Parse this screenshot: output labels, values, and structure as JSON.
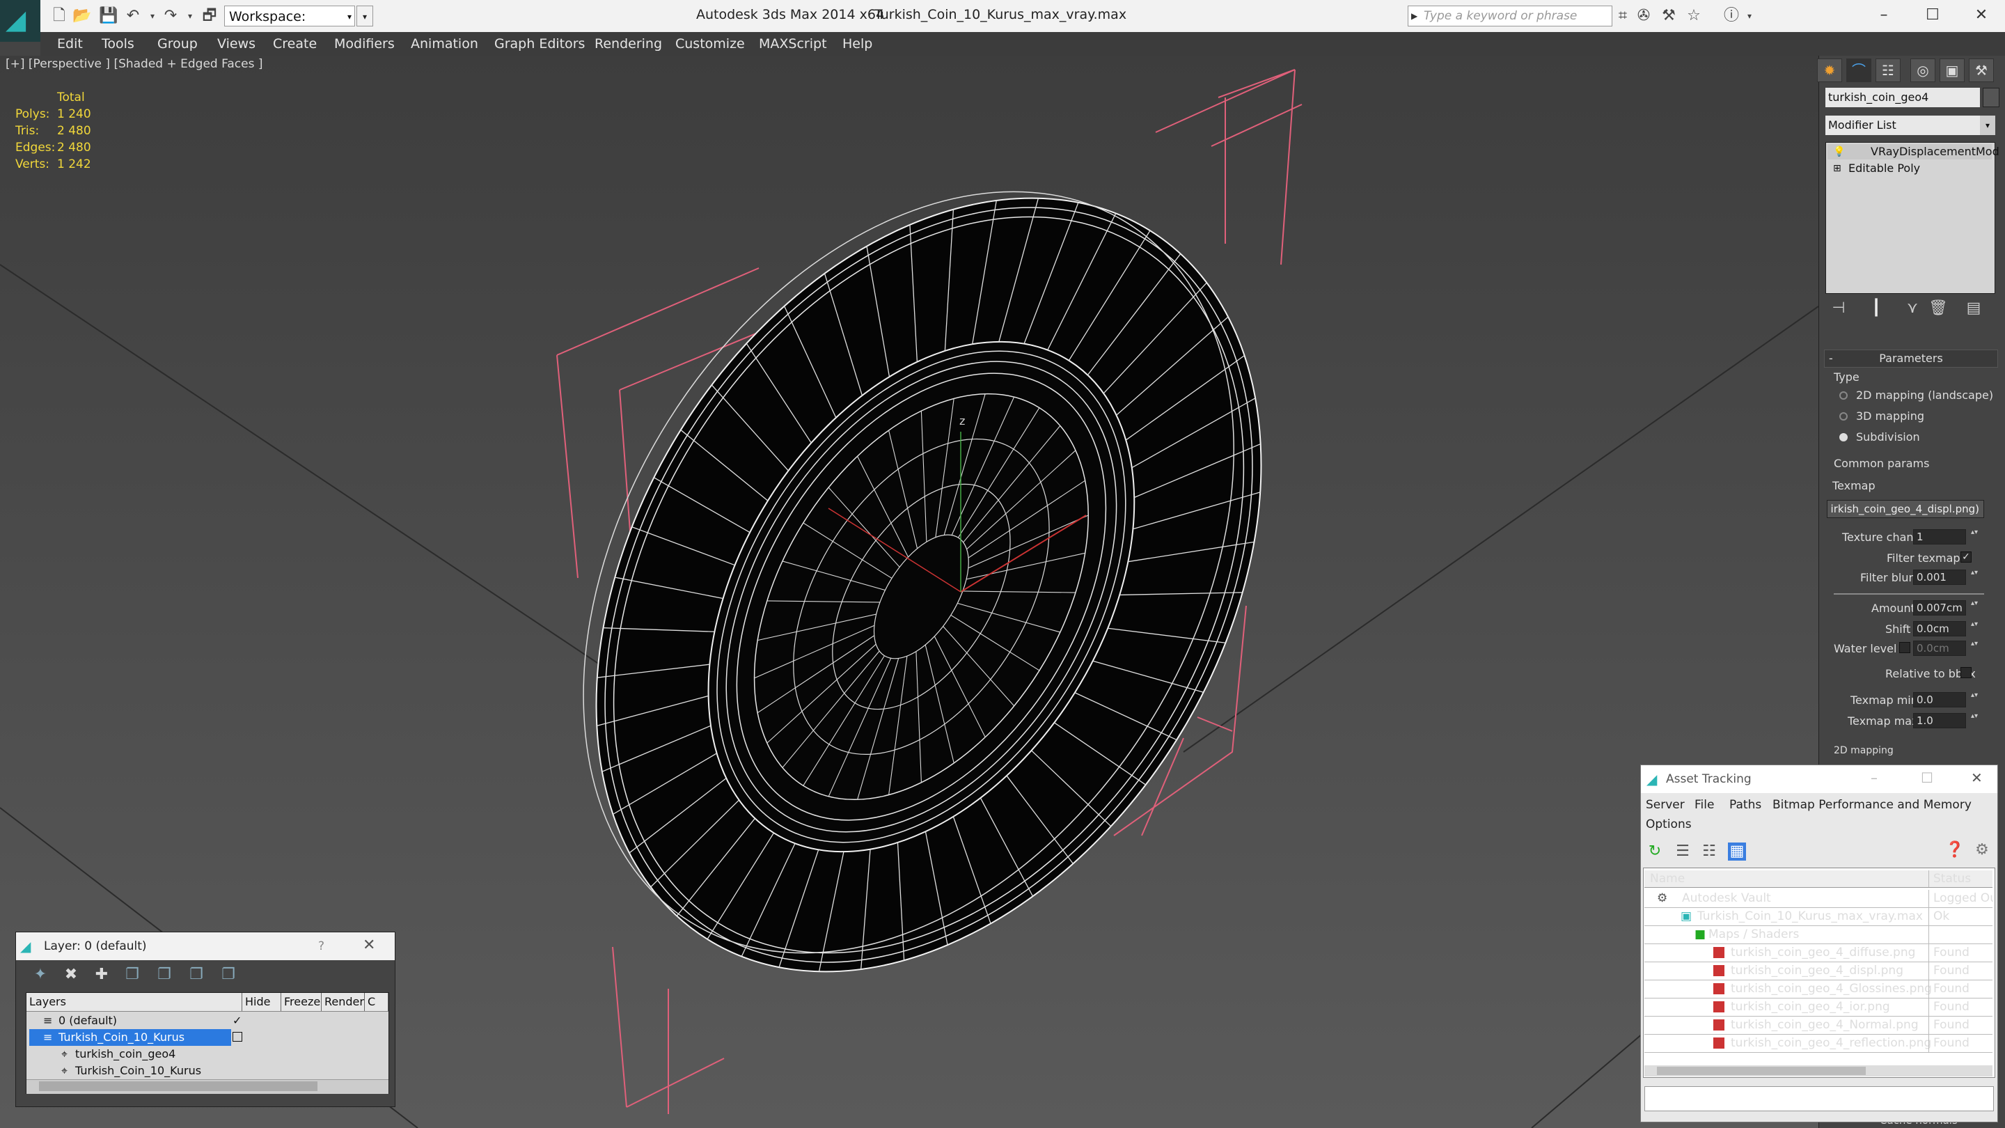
{
  "titlebar": {
    "app": "Autodesk 3ds Max  2014 x64",
    "file": "Turkish_Coin_10_Kurus_max_vray.max",
    "workspace": "Workspace: Default",
    "search_placeholder": "Type a keyword or phrase"
  },
  "menu": [
    "Edit",
    "Tools",
    "Group",
    "Views",
    "Create",
    "Modifiers",
    "Animation",
    "Graph Editors",
    "Rendering",
    "Customize",
    "MAXScript",
    "Help"
  ],
  "viewport": {
    "label": "[+] [Perspective ] [Shaded + Edged Faces ]",
    "stats": {
      "header": "Total",
      "polys_label": "Polys:",
      "polys": "1 240",
      "tris_label": "Tris:",
      "tris": "2 480",
      "edges_label": "Edges:",
      "edges": "2 480",
      "verts_label": "Verts:",
      "verts": "1 242"
    },
    "axis_label": "z"
  },
  "panel": {
    "object_name": "turkish_coin_geo4",
    "modifier_list": "Modifier List",
    "stack": [
      "VRayDisplacementMod",
      "Editable Poly"
    ],
    "rollout_title": "Parameters",
    "type_label": "Type",
    "type_options": [
      "2D mapping (landscape)",
      "3D mapping",
      "Subdivision"
    ],
    "common_params": "Common params",
    "texmap_label": "Texmap",
    "texmap_value": "irkish_coin_geo_4_displ.png)",
    "texture_chan_label": "Texture chan",
    "texture_chan": "1",
    "filter_texmap_label": "Filter texmap",
    "filter_blur_label": "Filter blur",
    "filter_blur": "0.001",
    "amount_label": "Amount",
    "amount": "0.007cm",
    "shift_label": "Shift",
    "shift": "0.0cm",
    "water_level_label": "Water level",
    "water_level": "0.0cm",
    "relative_bbox_label": "Relative to bbox",
    "texmap_min_label": "Texmap min",
    "texmap_min": "0.0",
    "texmap_max_label": "Texmap max",
    "texmap_max": "1.0",
    "mapping_2d": "2D mapping",
    "cache_normals": "Cache normals"
  },
  "layers": {
    "title": "Layer: 0 (default)",
    "help": "?",
    "columns": [
      "Layers",
      "Hide",
      "Freeze",
      "Render",
      "C"
    ],
    "rows": [
      "0 (default)",
      "Turkish_Coin_10_Kurus",
      "turkish_coin_geo4",
      "Turkish_Coin_10_Kurus"
    ]
  },
  "assets": {
    "title": "Asset Tracking",
    "menus": [
      "Server",
      "File",
      "Paths",
      "Bitmap Performance and Memory",
      "Options"
    ],
    "columns": [
      "Name",
      "Status"
    ],
    "rows": [
      {
        "name": "Autodesk Vault",
        "status": "Logged Out"
      },
      {
        "name": "Turkish_Coin_10_Kurus_max_vray.max",
        "status": "Ok"
      },
      {
        "name": "Maps / Shaders",
        "status": ""
      },
      {
        "name": "turkish_coin_geo_4_diffuse.png",
        "status": "Found"
      },
      {
        "name": "turkish_coin_geo_4_displ.png",
        "status": "Found"
      },
      {
        "name": "turkish_coin_geo_4_Glossines.png",
        "status": "Found"
      },
      {
        "name": "turkish_coin_geo_4_ior.png",
        "status": "Found"
      },
      {
        "name": "turkish_coin_geo_4_Normal.png",
        "status": "Found"
      },
      {
        "name": "turkish_coin_geo_4_reflection.png",
        "status": "Found"
      }
    ]
  }
}
